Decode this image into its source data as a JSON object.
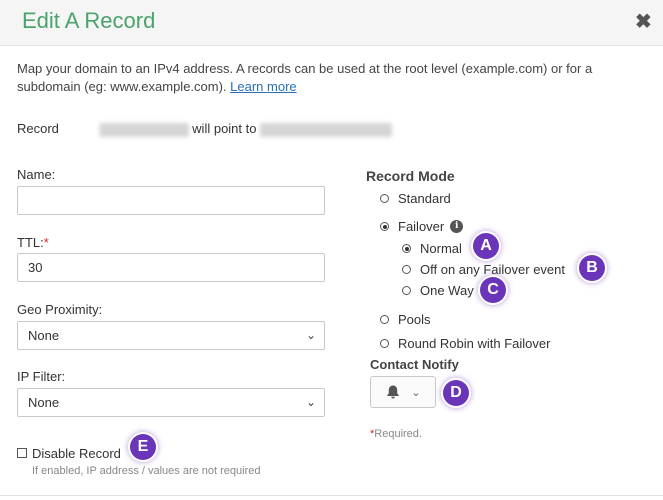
{
  "dialog": {
    "title": "Edit A Record",
    "close": "✖"
  },
  "description": {
    "text": "Map your domain to an IPv4 address. A records can be used at the root level (example.com) or for a subdomain (eg: www.example.com).",
    "link": "Learn more"
  },
  "record_line": {
    "prefix": "Record",
    "middle": "will point to"
  },
  "fields": {
    "name": {
      "label": "Name:",
      "value": ""
    },
    "ttl": {
      "label": "TTL:",
      "required_mark": "*",
      "value": "30"
    },
    "geo": {
      "label": "Geo Proximity:",
      "value": "None"
    },
    "ipfilter": {
      "label": "IP Filter:",
      "value": "None"
    }
  },
  "record_mode": {
    "title": "Record Mode",
    "options": [
      "Standard",
      "Failover",
      "Pools",
      "Round Robin with Failover"
    ],
    "selected": "Failover",
    "failover_info": "i",
    "failover_sub": [
      "Normal",
      "Off on any Failover event",
      "One Way"
    ],
    "failover_selected": "Normal"
  },
  "contact_notify": {
    "title": "Contact Notify",
    "icon": "bell-icon"
  },
  "required_note": {
    "star": "*",
    "text": "Required."
  },
  "disable_record": {
    "label": "Disable Record",
    "hint": "If enabled, IP address / values are not required",
    "checked": false
  },
  "annotations": [
    "A",
    "B",
    "C",
    "D",
    "E"
  ],
  "colors": {
    "title": "#4aa36b",
    "badge": "#6a35b8",
    "link": "#2a6fb8"
  }
}
